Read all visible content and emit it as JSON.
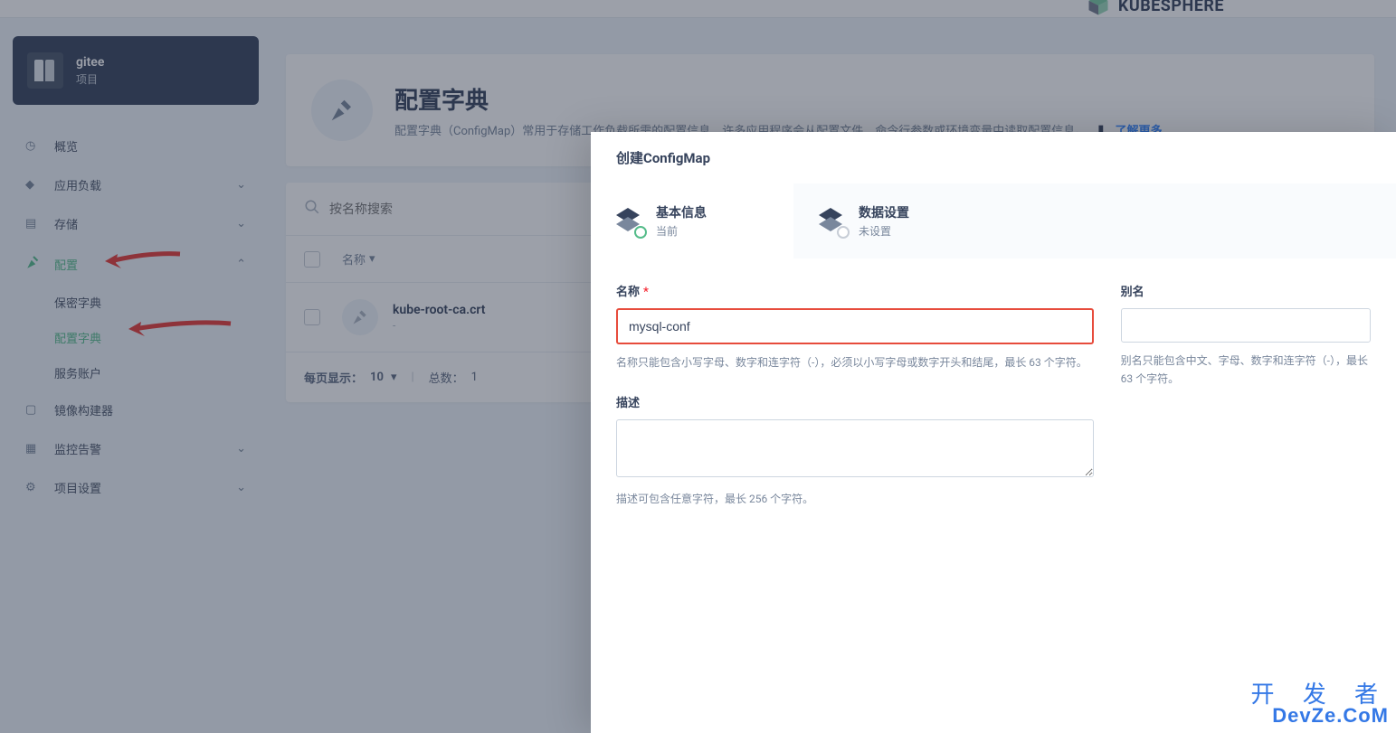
{
  "top": {
    "brand": "KUBESPHERE"
  },
  "sidebar": {
    "project": {
      "name": "gitee",
      "label": "项目"
    },
    "items": {
      "overview": "概览",
      "workload": "应用负载",
      "storage": "存储",
      "config": "配置",
      "config_children": {
        "secret": "保密字典",
        "configmap": "配置字典",
        "service_account": "服务账户"
      },
      "image_builder": "镜像构建器",
      "monitoring": "监控告警",
      "settings": "项目设置"
    }
  },
  "page": {
    "title": "配置字典",
    "desc": "配置字典（ConfigMap）常用于存储工作负载所需的配置信息，许多应用程序会从配置文件、命令行参数或环境变量中读取配置信息。",
    "learn_more": "了解更多"
  },
  "table": {
    "search_placeholder": "按名称搜索",
    "col_name": "名称",
    "rows": [
      {
        "name": "kube-root-ca.crt",
        "sub": "-"
      }
    ],
    "page_size_label": "每页显示：",
    "page_size": "10",
    "total_label": "总数：",
    "total": "1"
  },
  "modal": {
    "title": "创建ConfigMap",
    "step1": {
      "title": "基本信息",
      "sub": "当前"
    },
    "step2": {
      "title": "数据设置",
      "sub": "未设置"
    },
    "form": {
      "name_label": "名称",
      "name_value": "mysql-conf",
      "name_help": "名称只能包含小写字母、数字和连字符（-），必须以小写字母或数字开头和结尾，最长 63 个字符。",
      "alias_label": "别名",
      "alias_help": "别名只能包含中文、字母、数字和连字符（-），最长 63 个字符。",
      "desc_label": "描述",
      "desc_help": "描述可包含任意字符，最长 256 个字符。"
    }
  },
  "watermark": {
    "line1": "开 发 者",
    "line2": "DevZe.CoM"
  }
}
